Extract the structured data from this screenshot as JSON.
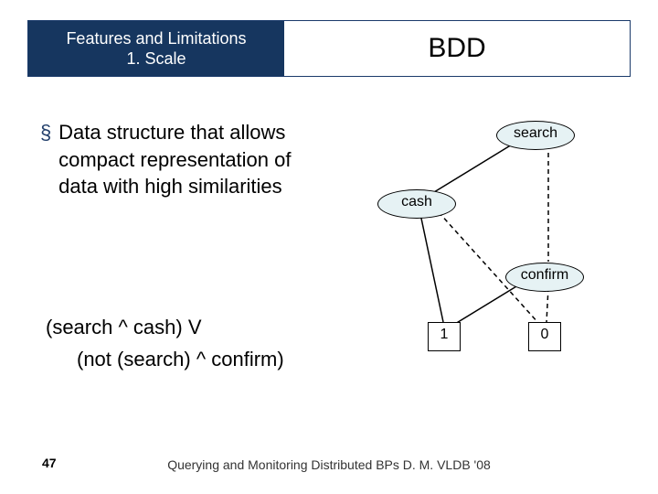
{
  "header": {
    "left_line1": "Features and Limitations",
    "left_line2": "1. Scale",
    "right": "BDD"
  },
  "bullet": {
    "marker": "§",
    "text": "Data structure that allows compact representation of data with high similarities"
  },
  "formula": {
    "line1": "(search ^ cash) V",
    "line2": "(not (search) ^ confirm)"
  },
  "diagram": {
    "nodes": {
      "search": "search",
      "cash": "cash",
      "confirm": "confirm",
      "one": "1",
      "zero": "0"
    }
  },
  "footer": "Querying and Monitoring Distributed BPs D. M. VLDB '08",
  "slide_number": "47"
}
